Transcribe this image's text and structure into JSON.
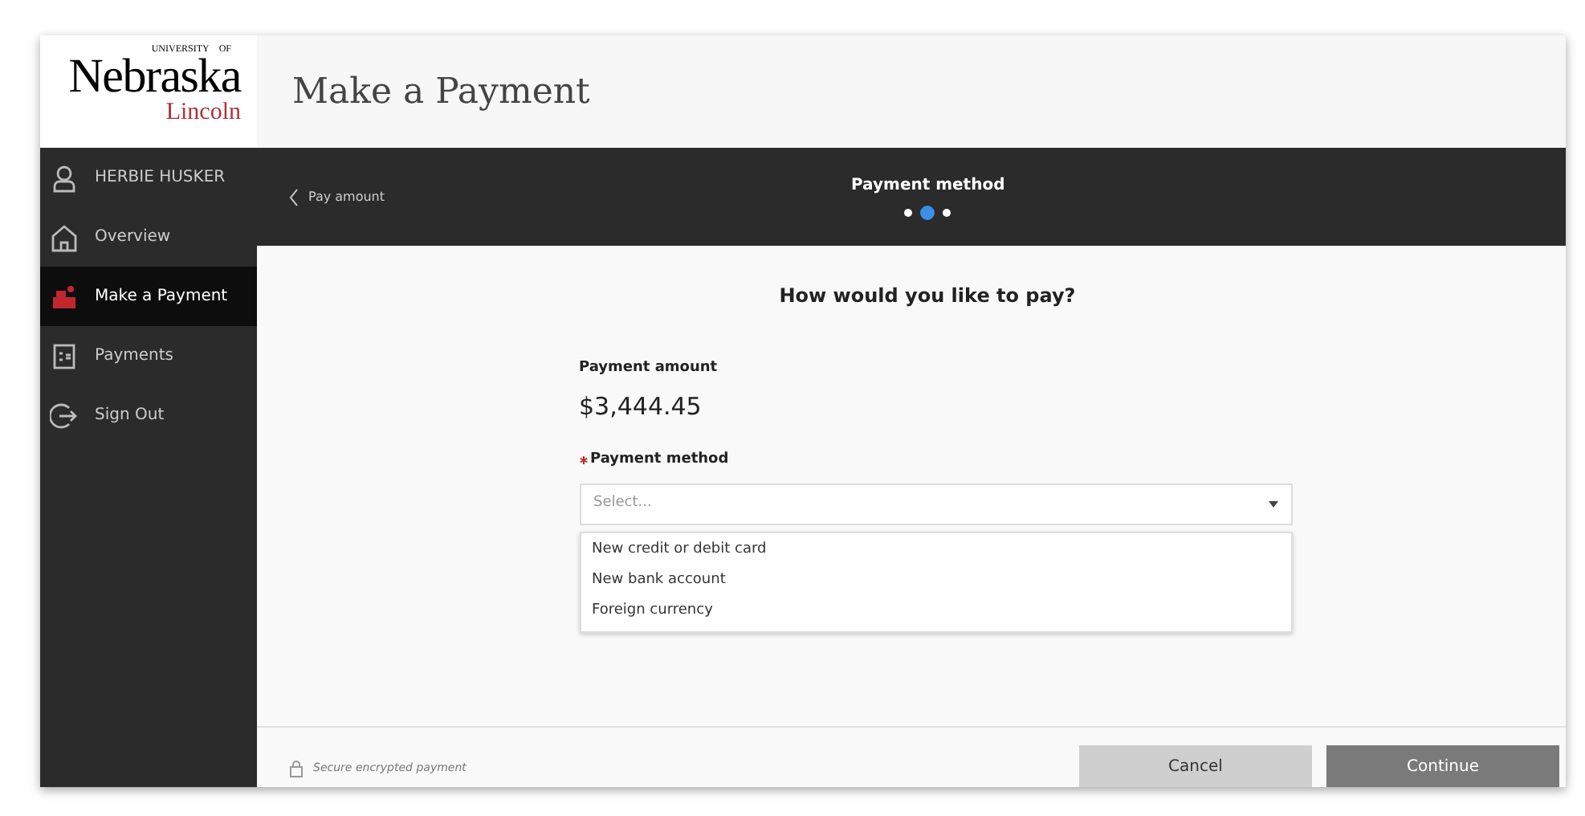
{
  "logo": {
    "top_left": "UNIVERSITY",
    "top_right": "OF",
    "name": "Nebraska",
    "campus": "Lincoln"
  },
  "page_title": "Make a Payment",
  "sidebar": {
    "items": [
      {
        "kind": "user",
        "label": "HERBIE HUSKER",
        "selected": false
      },
      {
        "kind": "home",
        "label": "Overview",
        "selected": false
      },
      {
        "kind": "payment",
        "label": "Make a Payment",
        "selected": true
      },
      {
        "kind": "receipt",
        "label": "Payments",
        "selected": false
      },
      {
        "kind": "signout",
        "label": "Sign Out",
        "selected": false
      }
    ]
  },
  "step_bar": {
    "back": "Pay amount",
    "title": "Payment method",
    "steps": [
      {
        "selected": false
      },
      {
        "selected": true
      },
      {
        "selected": false
      }
    ]
  },
  "question": "How would you like to pay?",
  "amount": {
    "label": "Payment amount",
    "value": "$3,444.45"
  },
  "method": {
    "label": "Payment method",
    "required": true,
    "placeholder": "Select...",
    "options": [
      "New credit or debit card",
      "New bank account",
      "Foreign currency"
    ]
  },
  "footer": {
    "secure": "Secure encrypted payment",
    "buttons": [
      "Cancel",
      "Continue"
    ]
  }
}
